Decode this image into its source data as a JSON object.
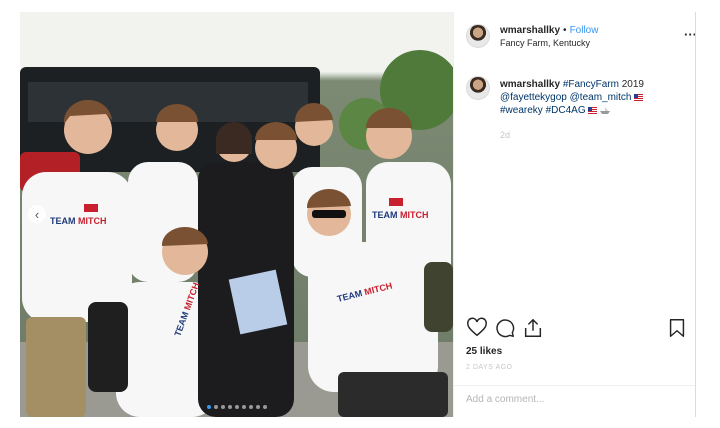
{
  "post": {
    "username": "wmarshallky",
    "separator": "•",
    "follow_label": "Follow",
    "location": "Fancy Farm, Kentucky",
    "more_icon": "more-horizontal-icon",
    "photo": {
      "shirt_text": "TEAM MITCH",
      "carousel_dots": 9,
      "active_dot": 0
    }
  },
  "caption": {
    "username": "wmarshallky",
    "hashtag_fancyfarm": "#FancyFarm",
    "year": "2019",
    "mention_fayette": "@fayettekygop",
    "mention_team_mitch": "@team_mitch",
    "hashtag_weareky": "#weareky",
    "hashtag_dc4ag": "#DC4AG",
    "time": "2d"
  },
  "actions": {
    "like_icon": "heart-icon",
    "comment_icon": "comment-icon",
    "share_icon": "share-icon",
    "save_icon": "bookmark-icon"
  },
  "likes": "25 likes",
  "post_date": "2 DAYS AGO",
  "comment": {
    "placeholder": "Add a comment..."
  },
  "colors": {
    "link": "#003569",
    "follow": "#3897f0",
    "muted": "#c7c7c7"
  }
}
